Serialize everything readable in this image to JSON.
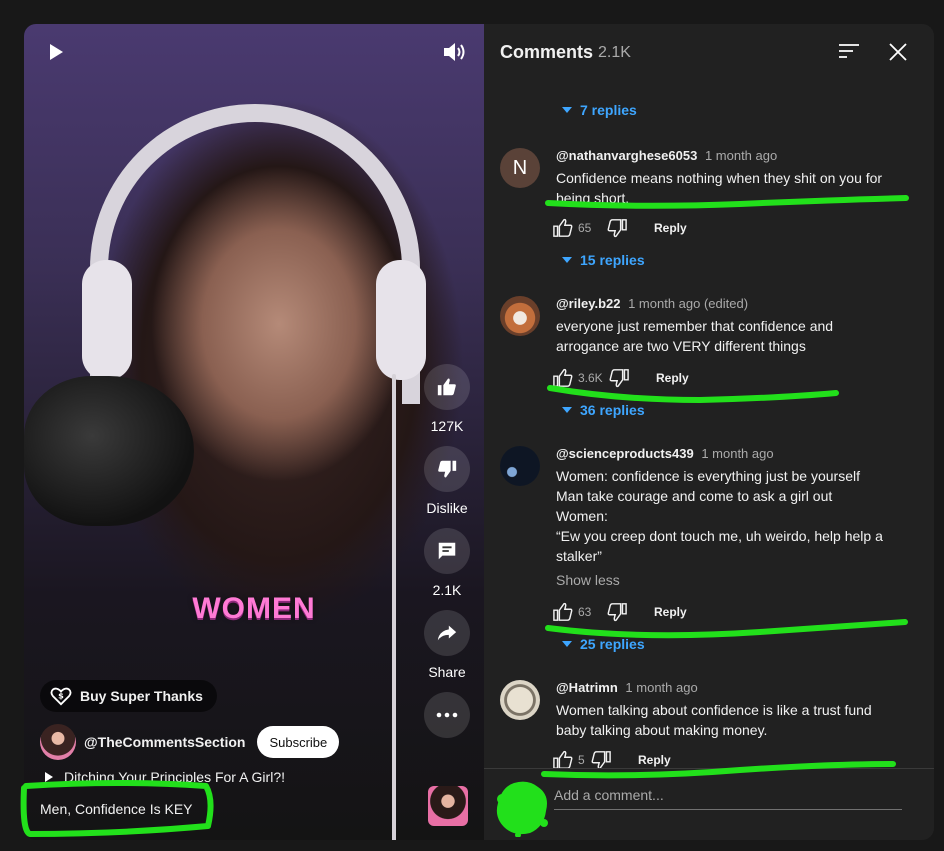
{
  "video": {
    "overlay_word": "WOMEN",
    "like_count": "127K",
    "dislike_label": "Dislike",
    "comment_count": "2.1K",
    "share_label": "Share",
    "super_thanks_label": "Buy Super Thanks",
    "channel_name": "@TheCommentsSection",
    "subscribe_label": "Subscribe",
    "playlist_title": "Ditching Your Principles For A Girl?!",
    "title": "Men, Confidence Is KEY"
  },
  "panel": {
    "title": "Comments",
    "count": "2.1K",
    "add_comment_placeholder": "Add a comment..."
  },
  "comments": [
    {
      "replies_label": "7 replies"
    },
    {
      "author": "@nathanvarghese6053",
      "time": "1 month ago",
      "avatar_letter": "N",
      "body": "Confidence means nothing when they shit on you for being short.",
      "likes": "65",
      "reply_label": "Reply",
      "replies_label": "15 replies"
    },
    {
      "author": "@riley.b22",
      "time": "1 month ago (edited)",
      "body": "everyone just remember that confidence and arrogance are two VERY different things",
      "likes": "3.6K",
      "reply_label": "Reply",
      "replies_label": "36 replies"
    },
    {
      "author": "@scienceproducts439",
      "time": "1 month ago",
      "body_lines": [
        "Women: confidence is everything just be yourself",
        "Man take courage and come to ask a girl out",
        "Women:",
        "“Ew you creep dont touch me, uh weirdo, help help a stalker”"
      ],
      "show_less": "Show less",
      "likes": "63",
      "reply_label": "Reply",
      "replies_label": "25 replies"
    },
    {
      "author": "@Hatrimn",
      "time": "1 month ago",
      "body": "Women talking about confidence is like a trust fund baby talking about making money.",
      "likes": "5",
      "reply_label": "Reply"
    }
  ],
  "colors": {
    "annotation_green": "#22e01b",
    "link_blue": "#3ea6ff",
    "panel_bg": "#212121",
    "overlay_pink": "#ff7ad5"
  }
}
